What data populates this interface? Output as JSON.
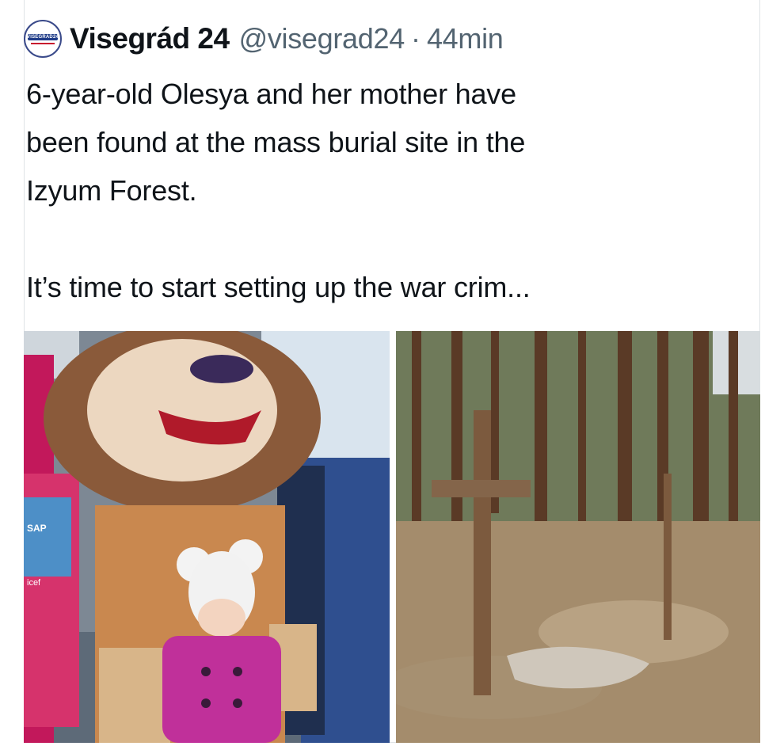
{
  "tweet": {
    "author_name": "Visegrád 24",
    "handle": "@visegrad24",
    "separator": "·",
    "time": "44min",
    "avatar_text": "VISEGRAD24",
    "text": "6-year-old Olesya and her mother have\nbeen found at the mass burial site in the\nIzyum Forest.\n\nIt’s time to start setting up the war crim..."
  },
  "photos": [
    {
      "backpack_label": "SAP",
      "sign_fragment": "icef"
    },
    {}
  ],
  "colors": {
    "text": "#0f1419",
    "secondary": "#536471",
    "border": "#dfe3e6",
    "logo_blue": "#1f3c88",
    "logo_red": "#c8102e"
  }
}
